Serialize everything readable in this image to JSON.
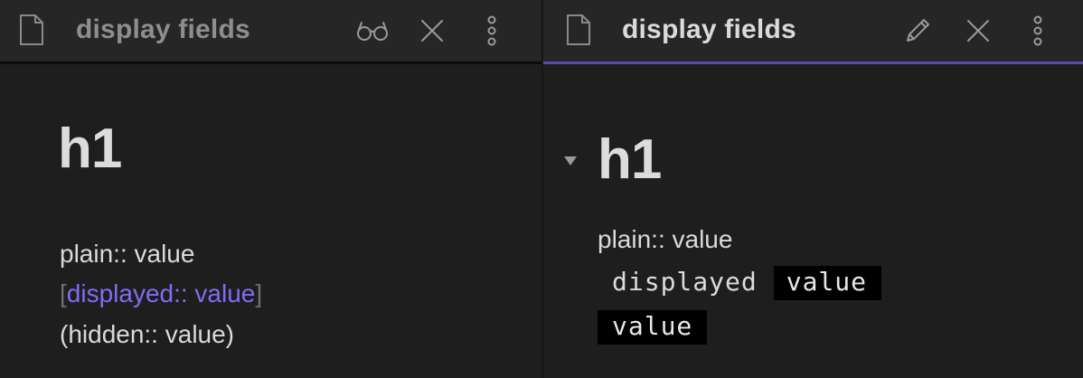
{
  "left_pane": {
    "tab": {
      "title": "display fields",
      "icons": [
        "document-icon",
        "reading-glasses-icon",
        "close-icon",
        "more-options-icon"
      ]
    },
    "heading": "h1",
    "lines": {
      "plain": "plain:: value",
      "bracket_open": "[",
      "displayed": "displayed:: value",
      "bracket_close": "]",
      "hidden": "(hidden:: value)"
    }
  },
  "right_pane": {
    "tab": {
      "title": "display fields",
      "icons": [
        "document-icon",
        "pencil-icon",
        "close-icon",
        "more-options-icon"
      ]
    },
    "heading": "h1",
    "plain_line": "plain:: value",
    "displayed_field": {
      "key": "displayed",
      "value": "value"
    },
    "hidden_field": {
      "value": "value"
    }
  },
  "colors": {
    "background": "#1e1e1e",
    "tab_background": "#262626",
    "accent": "#7f6df2",
    "active_tab_underline": "#5b48ad",
    "chip_background": "#000000"
  }
}
